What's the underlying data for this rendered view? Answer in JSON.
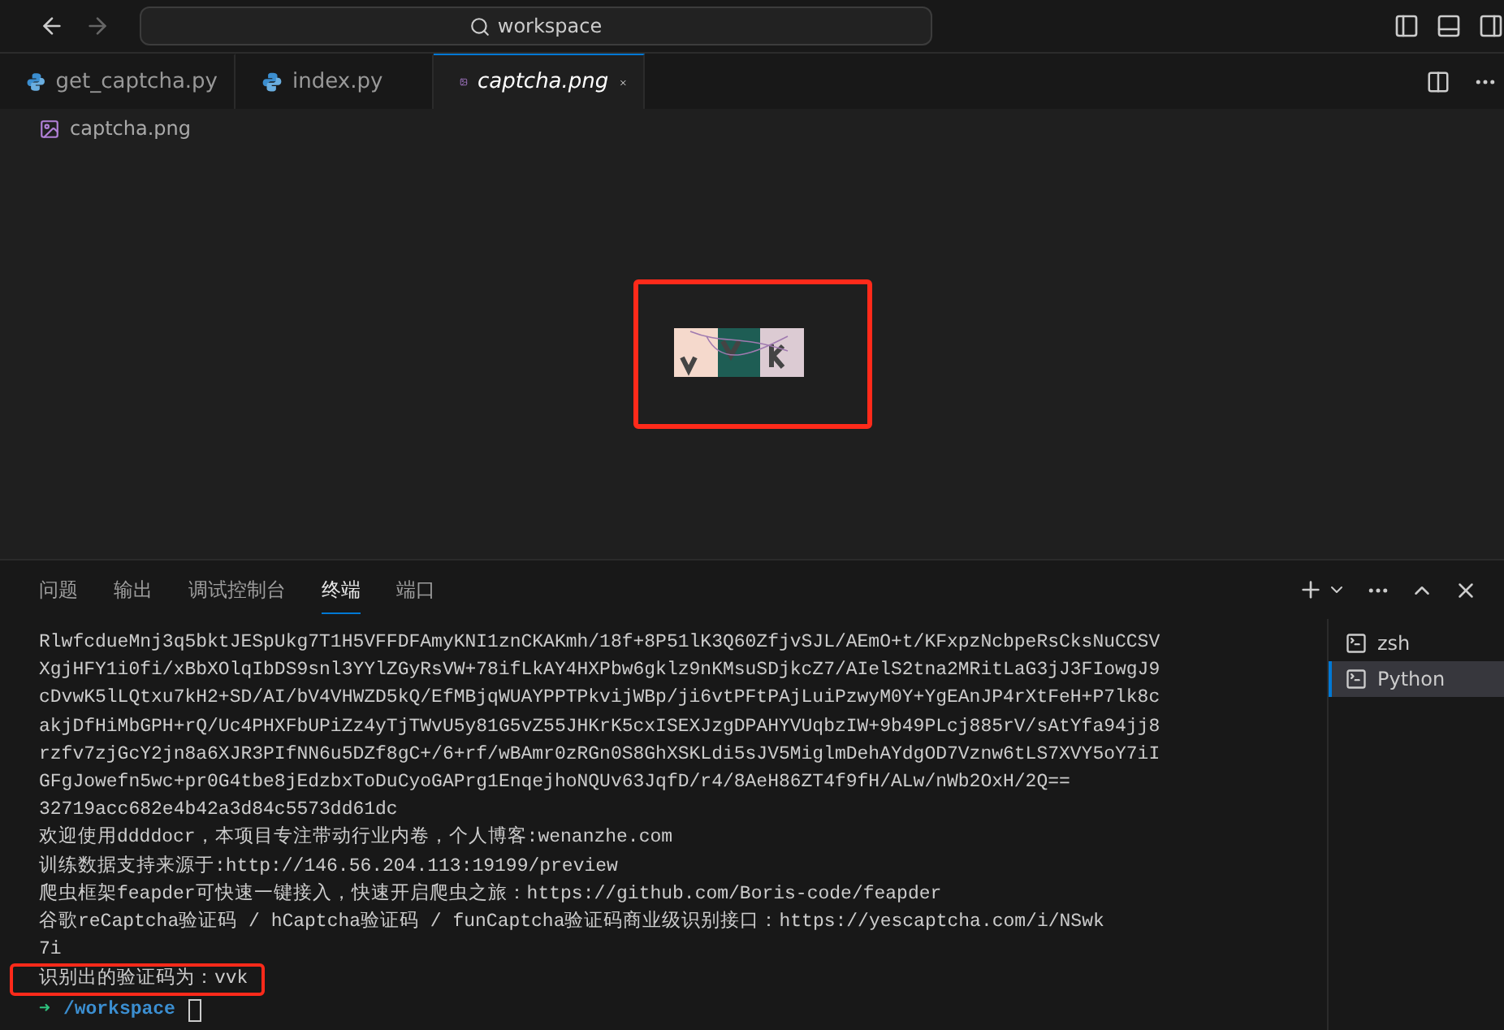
{
  "title_bar": {
    "search": "workspace"
  },
  "tabs": [
    {
      "label": "get_captcha.py",
      "kind": "python",
      "selected": false
    },
    {
      "label": "index.py",
      "kind": "python",
      "selected": false
    },
    {
      "label": "captcha.png",
      "kind": "image",
      "selected": true
    }
  ],
  "breadcrumb": "captcha.png",
  "image_view": {
    "highlighted": true
  },
  "panel": {
    "tabs": [
      {
        "label": "问题",
        "selected": false
      },
      {
        "label": "输出",
        "selected": false
      },
      {
        "label": "调试控制台",
        "selected": false
      },
      {
        "label": "终端",
        "selected": true
      },
      {
        "label": "端口",
        "selected": false
      }
    ],
    "terminal_lines": [
      {
        "text": "RlwfcdueMnj3q5bktJESpUkg7T1H5VFFDFAmyKNI1znCKAKmh/18f+8P51lK3Q60ZfjvSJL/AEmO+t/KFxpzNcbpeRsCksNuCCSV",
        "highlighted": false
      },
      {
        "text": "XgjHFY1i0fi/xBbXOlqIbDS9snl3YYlZGyRsVW+78ifLkAY4HXPbw6gklz9nKMsuSDjkcZ7/AIelS2tna2MRitLaG3jJ3FIowgJ9",
        "highlighted": false
      },
      {
        "text": "cDvwK5lLQtxu7kH2+SD/AI/bV4VHWZD5kQ/EfMBjqWUAYPPTPkvijWBp/ji6vtPFtPAjLuiPzwyM0Y+YgEAnJP4rXtFeH+P7lk8c",
        "highlighted": false
      },
      {
        "text": "akjDfHiMbGPH+rQ/Uc4PHXFbUPiZz4yTjTWvU5y81G5vZ55JHKrK5cxISEXJzgDPAHYVUqbzIW+9b49PLcj885rV/sAtYfa94jj8",
        "highlighted": false
      },
      {
        "text": "rzfv7zjGcY2jn8a6XJR3PIfNN6u5DZf8gC+/6+rf/wBAmr0zRGn0S8GhXSKLdi5sJV5MiglmDehAYdgOD7Vznw6tLS7XVY5oY7iI",
        "highlighted": false
      },
      {
        "text": "GFgJowefn5wc+pr0G4tbe8jEdzbxToDuCyoGAPrg1EnqejhoNQUv63JqfD/r4/8AeH86ZT4f9fH/ALw/nWb2OxH/2Q==",
        "highlighted": false
      },
      {
        "text": "32719acc682e4b42a3d84c5573dd61dc",
        "highlighted": false
      },
      {
        "text": "欢迎使用ddddocr，本项目专注带动行业内卷，个人博客:wenanzhe.com",
        "highlighted": false
      },
      {
        "text": "训练数据支持来源于:http://146.56.204.113:19199/preview",
        "highlighted": false
      },
      {
        "text": "爬虫框架feapder可快速一键接入，快速开启爬虫之旅：https://github.com/Boris-code/feapder",
        "highlighted": false
      },
      {
        "text": "谷歌reCaptcha验证码 / hCaptcha验证码 / funCaptcha验证码商业级识别接口：https://yescaptcha.com/i/NSwk",
        "highlighted": false
      },
      {
        "text": "7i",
        "highlighted": false
      },
      {
        "text": "识别出的验证码为：vvk",
        "highlighted": true
      }
    ],
    "prompt": {
      "arrow": "➜",
      "path": "/workspace"
    },
    "shells": [
      {
        "label": "zsh",
        "selected": false
      },
      {
        "label": "Python",
        "selected": true
      }
    ]
  }
}
